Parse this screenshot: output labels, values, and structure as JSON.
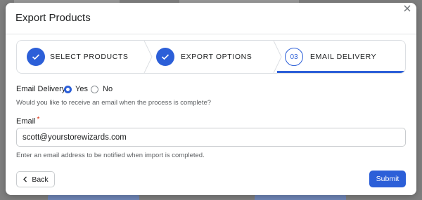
{
  "modal": {
    "title": "Export Products",
    "close_icon": "close-icon"
  },
  "stepper": {
    "steps": [
      {
        "label": "SELECT PRODUCTS",
        "status": "completed",
        "icon": "check-icon"
      },
      {
        "label": "EXPORT OPTIONS",
        "status": "completed",
        "icon": "check-icon"
      },
      {
        "label": "EMAIL DELIVERY",
        "status": "current",
        "number": "03"
      }
    ]
  },
  "email_delivery": {
    "label": "Email Delivery",
    "options": [
      {
        "label": "Yes",
        "selected": true
      },
      {
        "label": "No",
        "selected": false
      }
    ],
    "help_text": "Would you like to receive an email when the process is complete?"
  },
  "email": {
    "label": "Email",
    "required_marker": "*",
    "value": "scott@yourstorewizards.com",
    "help_text": "Enter an email address to be notified when import is completed."
  },
  "footer": {
    "back_label": "Back",
    "submit_label": "Submit"
  },
  "colors": {
    "accent": "#2c5fd8",
    "required": "#d72c0d",
    "backdrop": "#7f7f7f"
  }
}
